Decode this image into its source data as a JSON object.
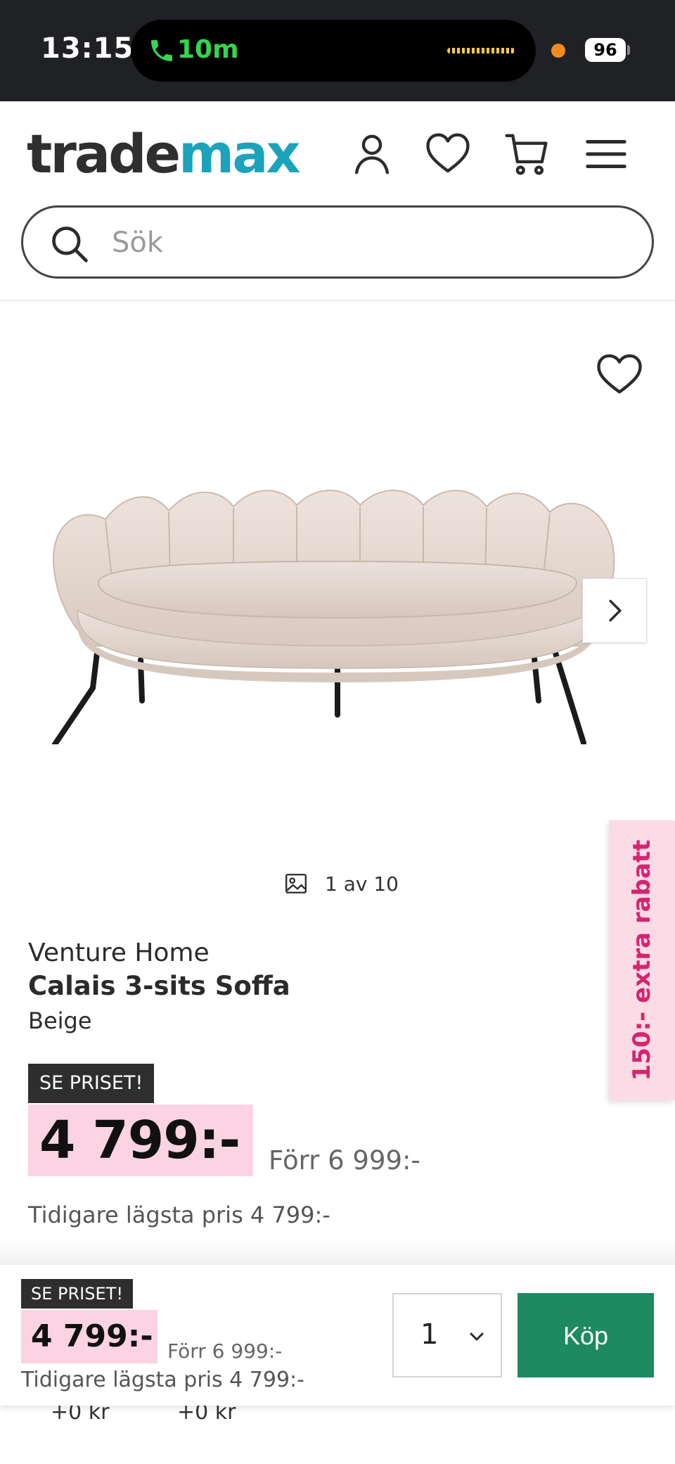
{
  "status_bar": {
    "time": "13:15",
    "call_duration": "10m",
    "battery": "96"
  },
  "header": {
    "logo_part1": "trade",
    "logo_part2": "max",
    "brand_color": "#1aa3bb",
    "icons": [
      "account-icon",
      "heart-icon",
      "cart-icon",
      "menu-icon"
    ]
  },
  "search": {
    "placeholder": "Sök",
    "value": ""
  },
  "gallery": {
    "counter": "1 av 10"
  },
  "promo_tab": {
    "label": "150:- extra rabatt",
    "color": "#d6246e"
  },
  "product": {
    "brand": "Venture Home",
    "name": "Calais 3-sits Soffa",
    "color": "Beige",
    "badge": "SE PRISET!",
    "price": "4 799:-",
    "old_price": "Förr 6 999:-",
    "lowest_price": "Tidigare lägsta pris 4 799:-"
  },
  "hidden_rows": {
    "value_1": "+0 kr",
    "value_2": "+0 kr"
  },
  "sticky_bar": {
    "badge": "SE PRISET!",
    "price": "4 799:-",
    "old_price": "Förr 6 999:-",
    "lowest_price": "Tidigare lägsta pris 4 799:-",
    "quantity": "1",
    "buy_label": "Köp",
    "buy_color": "#1d8a62"
  }
}
